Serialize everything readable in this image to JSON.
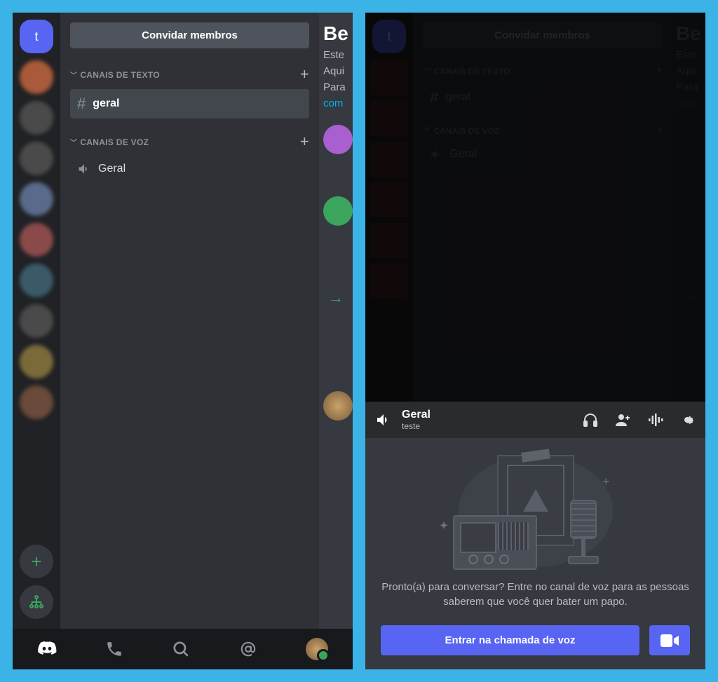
{
  "left": {
    "server_initial": "t",
    "invite_button": "Convidar membros",
    "text_category": "CANAIS DE TEXTO",
    "voice_category": "CANAIS DE VOZ",
    "text_channel": "geral",
    "voice_channel": "Geral",
    "peek": {
      "heading": "Be",
      "line1": "Este",
      "line2": "Aqui",
      "line3": "Para",
      "link": "com"
    }
  },
  "right": {
    "server_initial": "t",
    "invite_button": "Convidar membros",
    "text_category": "CANAIS DE TEXTO",
    "voice_category": "CANAIS DE VOZ",
    "text_channel": "geral",
    "voice_channel": "Geral",
    "peek": {
      "heading": "Be",
      "line1": "Este",
      "line2": "Aqui",
      "line3": "Para",
      "link": "com"
    },
    "voice_panel": {
      "title": "Geral",
      "subtitle": "teste",
      "prompt": "Pronto(a) para conversar? Entre no canal de voz para as pessoas saberem que você quer bater um papo.",
      "join_button": "Entrar na chamada de voz"
    }
  }
}
